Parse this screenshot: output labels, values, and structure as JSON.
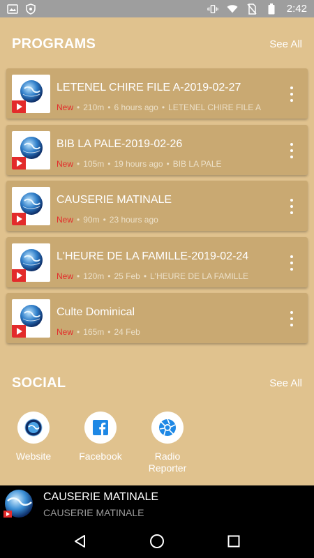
{
  "status_bar": {
    "time": "2:42",
    "icons": [
      "notification-icon",
      "shield-icon",
      "vibrate-icon",
      "wifi-icon",
      "no-sim-icon",
      "battery-icon"
    ]
  },
  "programs": {
    "title": "PROGRAMS",
    "see_all": "See All",
    "items": [
      {
        "title": "LETENEL CHIRE FILE A-2019-02-27",
        "badge": "New",
        "duration": "210m",
        "time": "6 hours ago",
        "show": "LETENEL CHIRE FILE A"
      },
      {
        "title": "BIB LA PALE-2019-02-26",
        "badge": "New",
        "duration": "105m",
        "time": "19 hours ago",
        "show": "BIB LA PALE"
      },
      {
        "title": "CAUSERIE MATINALE",
        "badge": "New",
        "duration": "90m",
        "time": "23 hours ago",
        "show": ""
      },
      {
        "title": "L'HEURE DE LA FAMILLE-2019-02-24",
        "badge": "New",
        "duration": "120m",
        "time": "25 Feb",
        "show": "L'HEURE DE LA FAMILLE"
      },
      {
        "title": "Culte Dominical",
        "badge": "New",
        "duration": "165m",
        "time": "24 Feb",
        "show": ""
      }
    ]
  },
  "social": {
    "title": "SOCIAL",
    "see_all": "See All",
    "items": [
      {
        "label": "Website",
        "icon": "globe-icon"
      },
      {
        "label": "Facebook",
        "icon": "facebook-icon"
      },
      {
        "label": "Radio\nReporter",
        "icon": "camera-shutter-icon"
      }
    ]
  },
  "now_playing": {
    "title": "CAUSERIE MATINALE",
    "subtitle": "CAUSERIE MATINALE"
  },
  "colors": {
    "background": "#e0c28e",
    "card": "#c9a972",
    "badge_new": "#e32b2b",
    "accent_blue": "#1e88e5",
    "player_bg": "#000000"
  }
}
